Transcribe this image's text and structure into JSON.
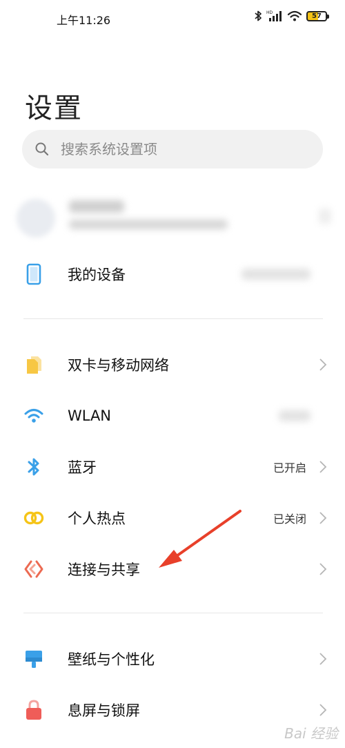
{
  "status_bar": {
    "time": "上午11:26",
    "battery": "57"
  },
  "header": {
    "title": "设置"
  },
  "search": {
    "placeholder": "搜索系统设置项"
  },
  "my_device": {
    "label": "我的设备"
  },
  "rows": [
    {
      "label": "双卡与移动网络",
      "value": "",
      "icon": "sim-card-icon"
    },
    {
      "label": "WLAN",
      "value": "",
      "icon": "wifi-icon"
    },
    {
      "label": "蓝牙",
      "value": "已开启",
      "icon": "bluetooth-icon"
    },
    {
      "label": "个人热点",
      "value": "已关闭",
      "icon": "hotspot-icon"
    },
    {
      "label": "连接与共享",
      "value": "",
      "icon": "connection-share-icon"
    }
  ],
  "rows2": [
    {
      "label": "壁纸与个性化",
      "value": "",
      "icon": "wallpaper-icon"
    },
    {
      "label": "息屏与锁屏",
      "value": "",
      "icon": "lock-icon"
    }
  ],
  "watermark": "Bai 经验",
  "colors": {
    "accent_blue": "#3aa0e8",
    "sim_yellow": "#f7c744",
    "hotspot_yellow": "#f5c418",
    "share_red": "#ec6a52",
    "lock_red": "#ef5d58",
    "arrow_red": "#e8402a"
  }
}
